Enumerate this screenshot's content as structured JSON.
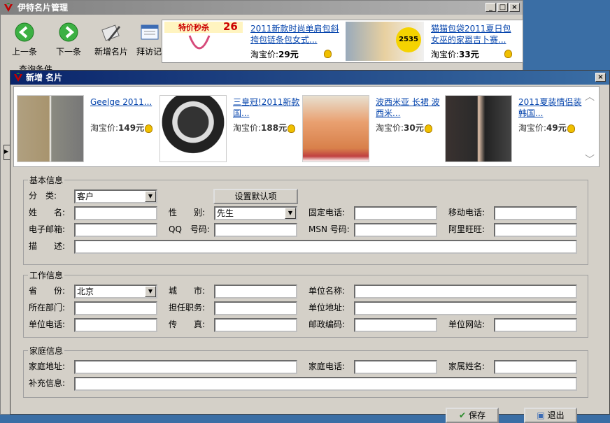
{
  "back_window": {
    "title": "伊特名片管理",
    "toolbar": [
      {
        "label": "上一条",
        "icon": "arrow-left-icon"
      },
      {
        "label": "下一条",
        "icon": "arrow-right-icon"
      },
      {
        "label": "新增名片",
        "icon": "pen-card-icon"
      },
      {
        "label": "拜访记",
        "icon": "notebook-icon"
      }
    ],
    "ads": [
      {
        "banner": "特价秒杀",
        "banner_num": "26",
        "title": "2011新款时尚单肩包斜挎包链条包女式...",
        "price_label": "淘宝价:",
        "price": "29元"
      },
      {
        "banner_num": "2535",
        "title": "猫猫包袋2011夏日包女巫的家嚣吉卜赛...",
        "price_label": "淘宝价:",
        "price": "33元"
      }
    ],
    "partial_label": "查询条件"
  },
  "dialog": {
    "title": "新增 名片",
    "products": [
      {
        "title": "Geelge 2011...",
        "price_label": "淘宝价:",
        "price": "149元"
      },
      {
        "title": "三皇冠!2011新款国...",
        "price_label": "淘宝价:",
        "price": "188元"
      },
      {
        "title": "波西米亚 长裙 波西米...",
        "price_label": "淘宝价:",
        "price": "30元"
      },
      {
        "title": "2011夏装情侣装韩国...",
        "price_label": "淘宝价:",
        "price": "49元"
      }
    ],
    "basic": {
      "legend": "基本信息",
      "category_label": "分　类:",
      "category_value": "客户",
      "set_default_button": "设置默认项",
      "name_label": "姓　　名:",
      "gender_label": "性　　别:",
      "gender_value": "先生",
      "phone_label": "固定电话:",
      "mobile_label": "移动电话:",
      "email_label": "电子邮箱:",
      "qq_label": "QQ　号码:",
      "msn_label": "MSN 号码:",
      "wangwang_label": "阿里旺旺:",
      "desc_label": "描　　述:"
    },
    "work": {
      "legend": "工作信息",
      "province_label": "省　　份:",
      "province_value": "北京",
      "city_label": "城　　市:",
      "company_label": "单位名称:",
      "dept_label": "所在部门:",
      "position_label": "担任职务:",
      "address_label": "单位地址:",
      "work_phone_label": "单位电话:",
      "fax_label": "传　　真:",
      "zip_label": "邮政编码:",
      "website_label": "单位网站:"
    },
    "home": {
      "legend": "家庭信息",
      "address_label": "家庭地址:",
      "phone_label": "家庭电话:",
      "family_label": "家属姓名:",
      "extra_label": "补充信息:"
    },
    "save_button": "保存",
    "exit_button": "退出"
  },
  "colors": {
    "dialog_title": "#0a246a",
    "inactive_title": "#808080",
    "window_bg": "#d4d0c8",
    "link": "#0645ad"
  }
}
